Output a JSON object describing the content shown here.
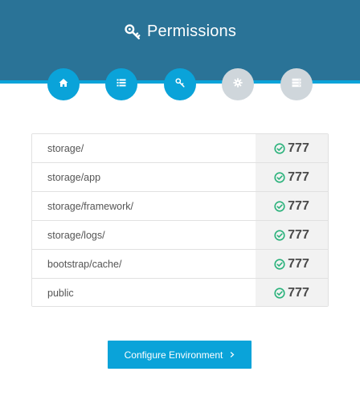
{
  "header": {
    "title": "Permissions",
    "icon": "key-icon",
    "colors": {
      "background": "#2a7397",
      "accent": "#0aa3d9"
    }
  },
  "steps": [
    {
      "icon": "home-icon",
      "state": "done"
    },
    {
      "icon": "list-icon",
      "state": "done"
    },
    {
      "icon": "key-icon",
      "state": "current"
    },
    {
      "icon": "gear-icon",
      "state": "pending"
    },
    {
      "icon": "server-icon",
      "state": "pending"
    }
  ],
  "permissions": [
    {
      "path": "storage/",
      "value": "777",
      "status": "ok"
    },
    {
      "path": "storage/app",
      "value": "777",
      "status": "ok"
    },
    {
      "path": "storage/framework/",
      "value": "777",
      "status": "ok"
    },
    {
      "path": "storage/logs/",
      "value": "777",
      "status": "ok"
    },
    {
      "path": "bootstrap/cache/",
      "value": "777",
      "status": "ok"
    },
    {
      "path": "public",
      "value": "777",
      "status": "ok"
    }
  ],
  "status_color": "#2ab27b",
  "actions": {
    "next_label": "Configure Environment",
    "next_icon": "chevron-right-icon"
  }
}
